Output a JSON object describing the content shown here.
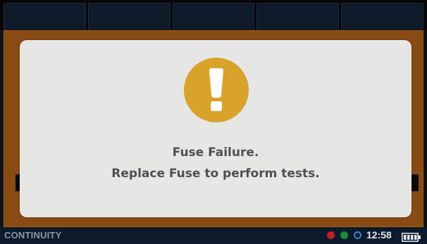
{
  "modal": {
    "message_line1": "Fuse Failure.",
    "message_line2": "Replace Fuse to perform tests.",
    "icon": "warning-exclamation-icon",
    "icon_color": "#d9a22b"
  },
  "panel": {
    "color": "#8a4a14"
  },
  "status_bar": {
    "mode_label": "CONTINUITY",
    "time": "12:58",
    "indicators": [
      {
        "name": "red-indicator",
        "color": "#c11e22"
      },
      {
        "name": "green-indicator",
        "color": "#1f8a3c"
      },
      {
        "name": "blue-indicator",
        "color": "#3b82d4"
      }
    ],
    "battery_icon": "battery-icon"
  }
}
